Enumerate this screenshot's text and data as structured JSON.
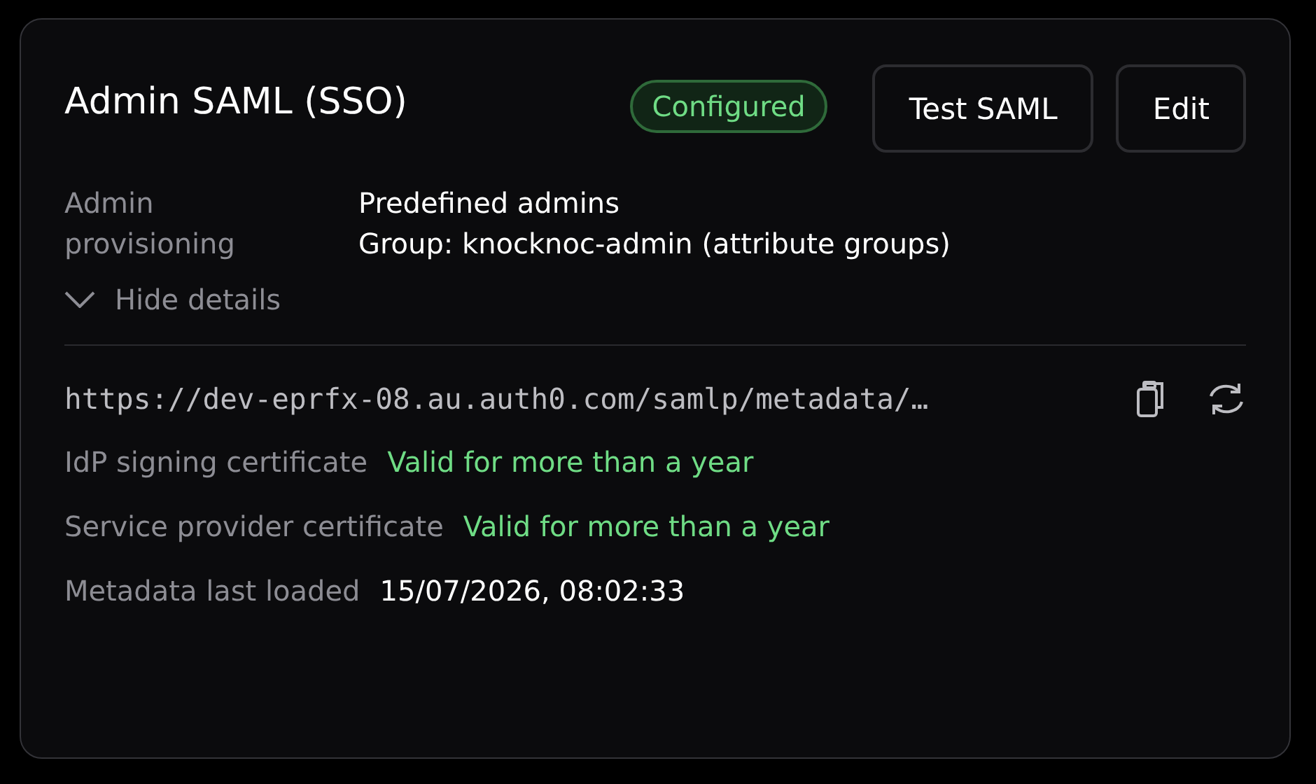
{
  "card": {
    "title": "Admin SAML (SSO)",
    "status": {
      "label": "Configured",
      "kind": "success"
    },
    "buttons": [
      "Test SAML",
      "Edit"
    ],
    "provisioning": {
      "label": "Admin provisioning",
      "values": [
        "Predefined admins",
        "Group: knocknoc-admin (attribute groups)"
      ]
    },
    "details_toggle": {
      "label": "Hide details",
      "expanded": true
    },
    "metadata_url": "https://dev-eprfx-08.au.auth0.com/samlp/metadata/…",
    "facts": [
      {
        "label": "IdP signing certificate",
        "value": "Valid for more than a year",
        "kind": "ok"
      },
      {
        "label": "Service provider certificate",
        "value": "Valid for more than a year",
        "kind": "ok"
      },
      {
        "label": "Metadata last loaded",
        "value": "15/07/2026, 08:02:33",
        "kind": "plain"
      }
    ]
  }
}
